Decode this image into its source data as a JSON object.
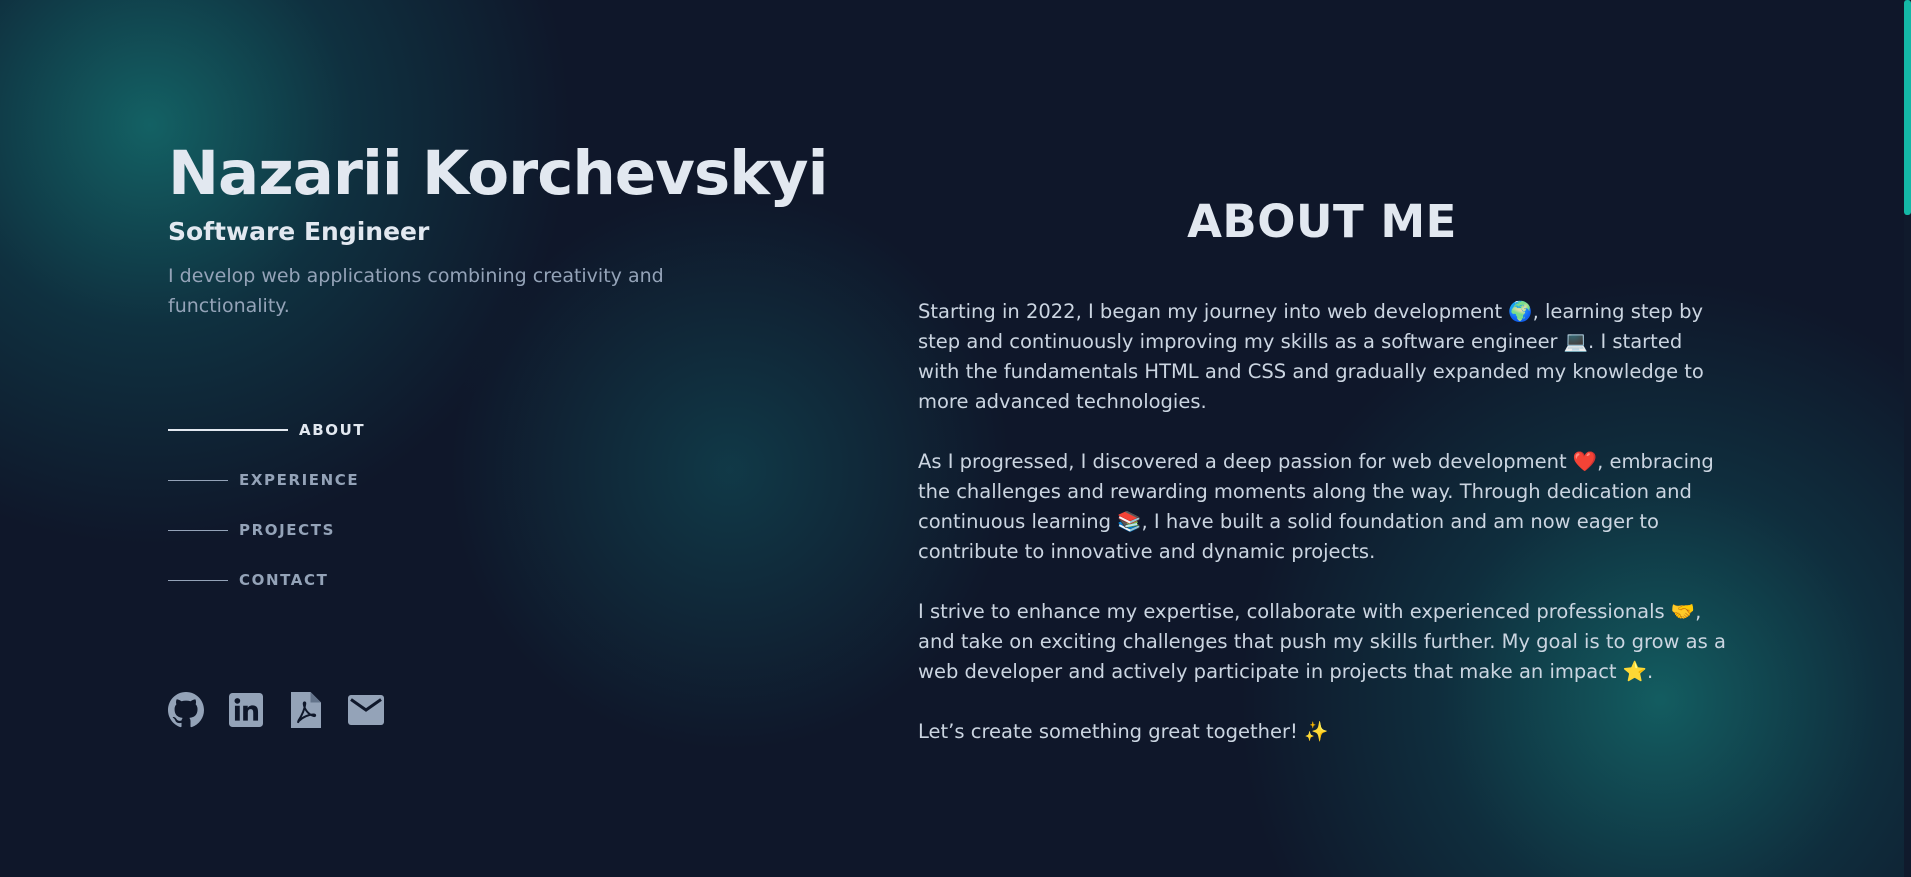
{
  "header": {
    "name": "Nazarii Korchevskyi",
    "role": "Software Engineer",
    "tagline": "I develop web applications combining creativity and functionality."
  },
  "nav": {
    "items": [
      {
        "label": "ABOUT",
        "active": true
      },
      {
        "label": "EXPERIENCE",
        "active": false
      },
      {
        "label": "PROJECTS",
        "active": false
      },
      {
        "label": "CONTACT",
        "active": false
      }
    ]
  },
  "socials": [
    {
      "icon": "github-icon"
    },
    {
      "icon": "linkedin-icon"
    },
    {
      "icon": "pdf-resume-icon"
    },
    {
      "icon": "email-icon"
    }
  ],
  "about": {
    "heading": "ABOUT ME",
    "paragraphs": [
      "Starting in 2022, I began my journey into web development 🌍, learning step by step and continuously improving my skills as a software engineer 💻. I started with the fundamentals HTML and CSS and gradually expanded my knowledge to more advanced technologies.",
      "As I progressed, I discovered a deep passion for web development ❤️, embracing the challenges and rewarding moments along the way. Through dedication and continuous learning 📚, I have built a solid foundation and am now eager to contribute to innovative and dynamic projects.",
      "I strive to enhance my expertise, collaborate with experienced professionals 🤝, and take on exciting challenges that push my skills further. My goal is to grow as a web developer and actively participate in projects that make an impact ⭐.",
      "Let’s create something great together! ✨"
    ]
  },
  "colors": {
    "background": "#0f172a",
    "heading": "#e2e8f0",
    "body_text": "#cbd5e1",
    "muted_text": "#94a3b8",
    "accent": "#14b8a6"
  }
}
